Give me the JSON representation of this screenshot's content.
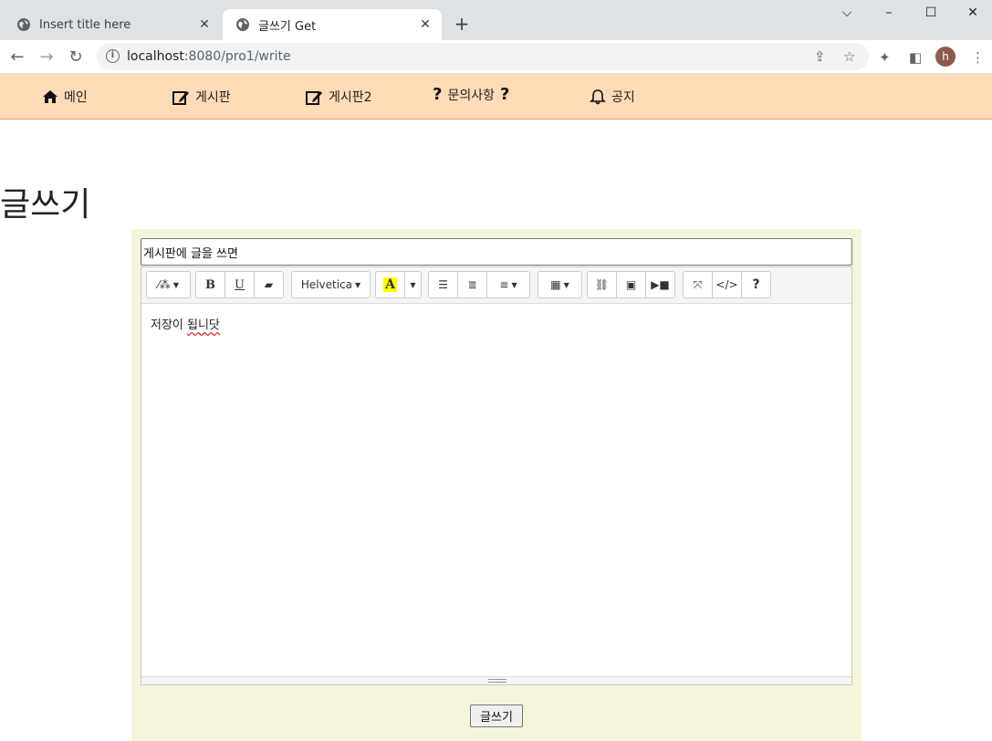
{
  "browser": {
    "tabs": [
      {
        "title": "Insert title here",
        "active": false
      },
      {
        "title": "글쓰기 Get",
        "active": true
      }
    ],
    "new_tab": "+",
    "url_host": "localhost",
    "url_path": ":8080/pro1/write",
    "avatar_letter": "h"
  },
  "sitenav": {
    "items": [
      {
        "label": "메인",
        "icon": "home-icon"
      },
      {
        "label": "게시판",
        "icon": "edit-icon"
      },
      {
        "label": "게시판2",
        "icon": "edit-icon"
      },
      {
        "label": "문의사항",
        "icon": "question-icon"
      },
      {
        "label": "공지",
        "icon": "bell-icon"
      }
    ],
    "bg_color": "#ffdbb8"
  },
  "page": {
    "title": "글쓰기"
  },
  "form": {
    "title_value": "게시판에 글을 쓰면",
    "editor": {
      "font_name": "Helvetica",
      "content_prefix": "저장이 ",
      "content_misspelled": "됩니닷"
    },
    "submit_label": "글쓰기",
    "bg_color": "#f5f5dc"
  }
}
